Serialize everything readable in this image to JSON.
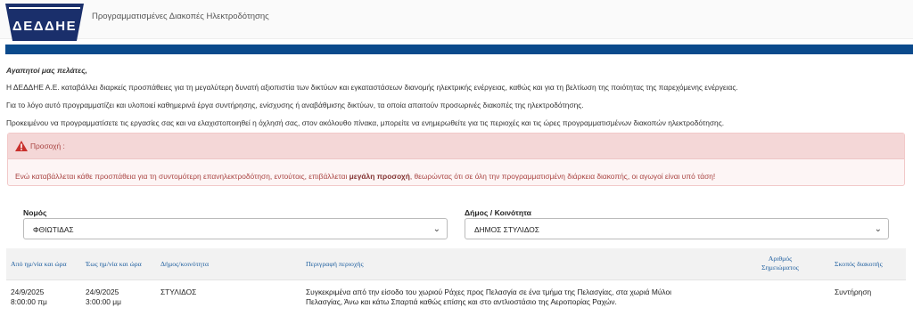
{
  "header": {
    "logo_text": "ΔΕΔΔΗΕ",
    "title": "Προγραμματισμένες Διακοπές Ηλεκτροδότησης"
  },
  "intro": {
    "greeting": "Αγαπητοί μας πελάτες,",
    "p1": "Η ΔΕΔΔΗΕ Α.Ε. καταβάλλει διαρκείς προσπάθειες για τη μεγαλύτερη δυνατή αξιοπιστία των δικτύων και εγκαταστάσεων διανομής ηλεκτρικής ενέργειας, καθώς και για τη βελτίωση της ποιότητας της παρεχόμενης ενέργειας.",
    "p2": "Για το λόγο αυτό προγραμματίζει και υλοποιεί καθημερινά έργα συντήρησης, ενίσχυσης ή αναβάθμισης δικτύων, τα οποία απαιτούν προσωρινές διακοπές της ηλεκτροδότησης.",
    "p3": "Προκειμένου να προγραμματίσετε τις εργασίες σας και να ελαχιστοποιηθεί η όχλησή σας, στον ακόλουθο πίνακα, μπορείτε να ενημερωθείτε για τις περιοχές και τις ώρες προγραμματισμένων διακοπών ηλεκτροδότησης."
  },
  "alert": {
    "heading": "Προσοχή :",
    "text_before": "Ενώ καταβάλλεται κάθε προσπάθεια για τη συντομότερη επανηλεκτροδότηση, εντούτοις, επιβάλλεται ",
    "text_bold": "μεγάλη προσοχή",
    "text_after": ", θεωρώντας ότι σε όλη την προγραμματισμένη διάρκεια διακοπής, οι αγωγοί είναι υπό τάση!"
  },
  "filters": {
    "prefecture_label": "Νομός",
    "prefecture_value": "ΦΘΙΩΤΙΔΑΣ",
    "municipality_label": "Δήμος / Κοινότητα",
    "municipality_value": "ΔΗΜΟΣ ΣΤΥΛΙΔΟΣ"
  },
  "table": {
    "headers": {
      "from": "Από ημ/νία και ώρα",
      "to": "Έως ημ/νία και ώρα",
      "municipality": "Δήμος/κοινότητα",
      "description": "Περιγραφή περιοχής",
      "note_line1": "Αριθμός",
      "note_line2": "Σημειώματος",
      "purpose": "Σκοπός διακοπής"
    },
    "rows": [
      {
        "from_date": "24/9/2025",
        "from_time": "8:00:00 πμ",
        "to_date": "24/9/2025",
        "to_time": "3:00:00 μμ",
        "municipality": "ΣΤΥΛΙΔΟΣ",
        "description_line1": "Συγκεκριμένα από την είσοδο του χωριού Ράχες προς Πελασγία σε ένα τμήμα της Πελασγίας, στα χωριά Μύλοι",
        "description_line2": "Πελασγίας, Άνω και κάτω Σπαρτιά καθώς επίσης και στο αντλιοστάσιο της Αεροπορίας Ραχών.",
        "note": "",
        "purpose": "Συντήρηση"
      }
    ]
  },
  "colors": {
    "brand_blue": "#0b4a8c",
    "logo_navy": "#1a2f6b",
    "alert_red": "#a94442",
    "link_blue": "#1f5f9f"
  },
  "icons": {
    "alert": "warning-triangle-icon",
    "select": "chevron-down-icon"
  }
}
